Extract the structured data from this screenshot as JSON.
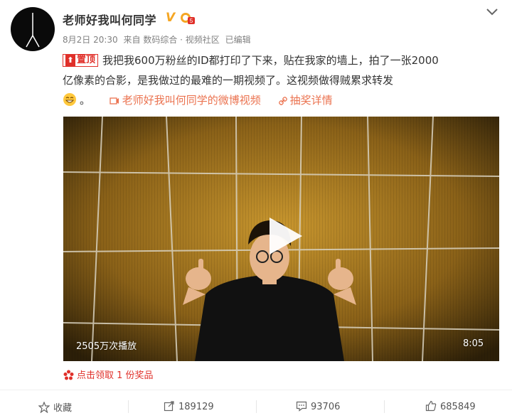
{
  "post": {
    "author": "老师好我叫何同学",
    "verified_mark": "V",
    "meta": {
      "date": "8月2日 20:30",
      "source": "来自 数码综合 · 视频社区",
      "edited": "已编辑"
    },
    "pin_label": "置顶",
    "text_line1": "我把我600万粉丝的ID都打印了下来，贴在我家的墙上，拍了一张2000",
    "text_line2": "亿像素的合影，是我做过的最难的一期视频了。这视频做得贼累求转发",
    "text_after_emoji": "。",
    "video_link": "老师好我叫何同学的微博视频",
    "lottery_link": "抽奖详情"
  },
  "video": {
    "play_count": "2505万次播放",
    "duration": "8:05"
  },
  "prize": {
    "label": "点击领取 1 份奖品"
  },
  "footer": {
    "favorite": "收藏",
    "repost": "189129",
    "comment": "93706",
    "like": "685849"
  },
  "colors": {
    "accent_red": "#e0302a",
    "link_orange": "#eb7350",
    "verified_gold": "#f5a623"
  }
}
